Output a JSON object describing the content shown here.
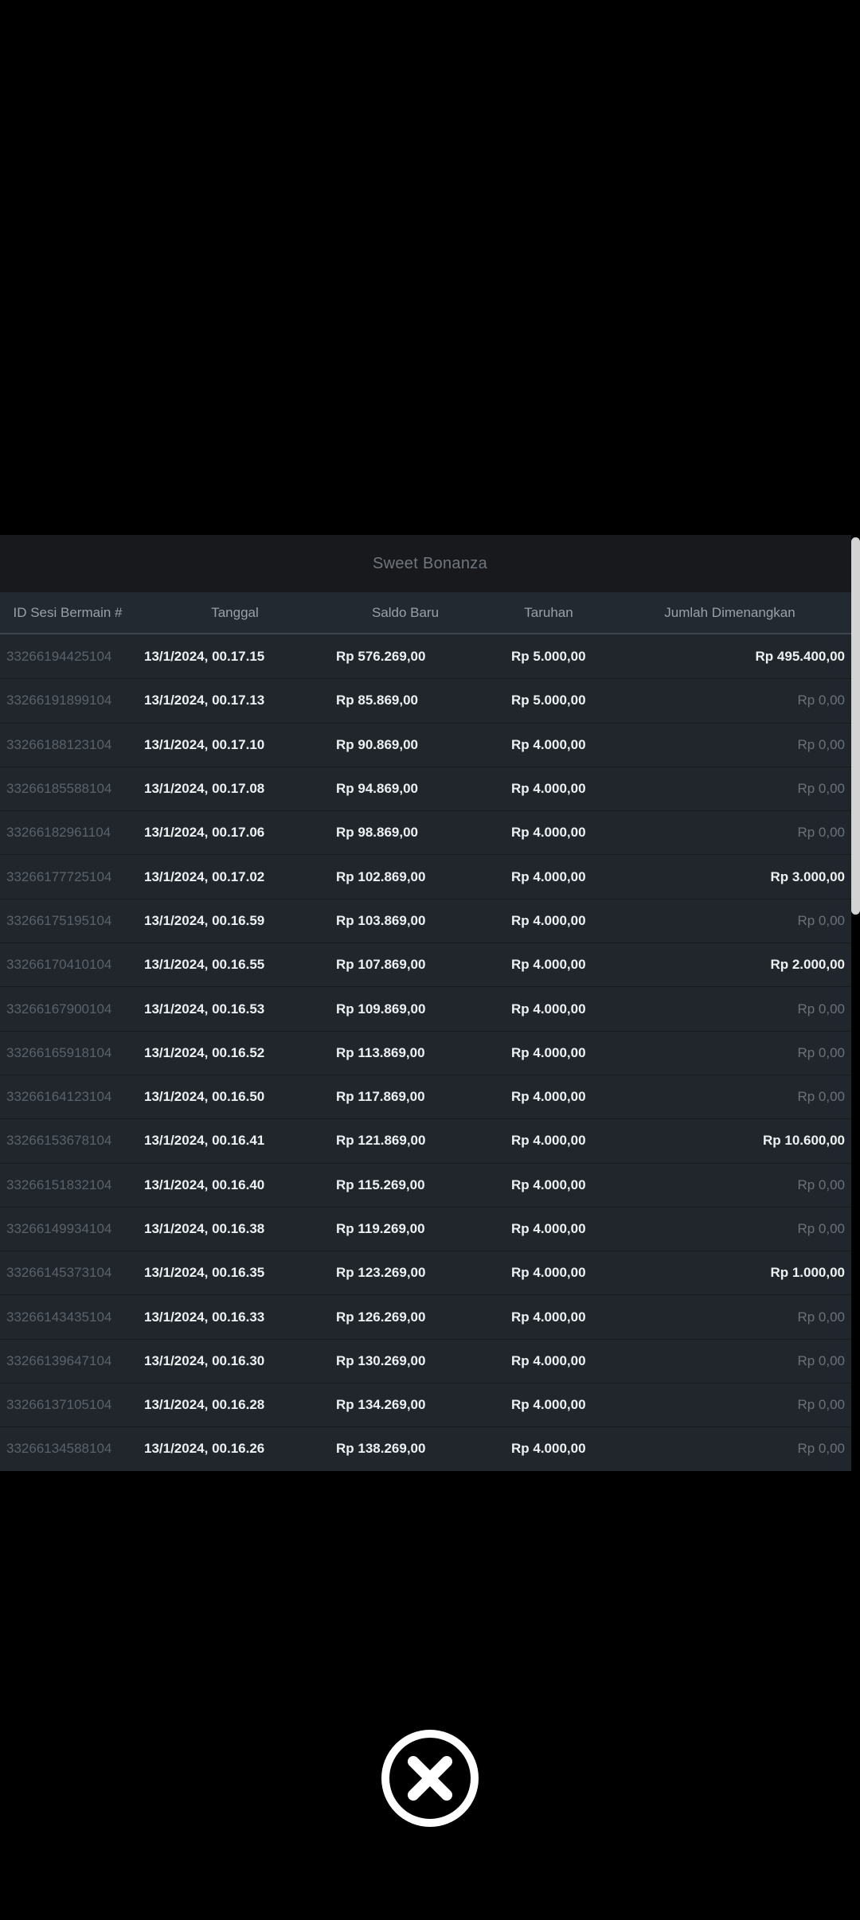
{
  "modal": {
    "title": "Sweet Bonanza",
    "columns": [
      "ID Sesi Bermain #",
      "Tanggal",
      "Saldo Baru",
      "Taruhan",
      "Jumlah Dimenangkan"
    ],
    "zero_value": "Rp 0,00",
    "rows": [
      {
        "id": "33266194425104",
        "tanggal": "13/1/2024, 00.17.15",
        "saldo_baru": "Rp 576.269,00",
        "taruhan": "Rp 5.000,00",
        "jumlah_dimenangkan": "Rp 495.400,00"
      },
      {
        "id": "33266191899104",
        "tanggal": "13/1/2024, 00.17.13",
        "saldo_baru": "Rp 85.869,00",
        "taruhan": "Rp 5.000,00",
        "jumlah_dimenangkan": "Rp 0,00"
      },
      {
        "id": "33266188123104",
        "tanggal": "13/1/2024, 00.17.10",
        "saldo_baru": "Rp 90.869,00",
        "taruhan": "Rp 4.000,00",
        "jumlah_dimenangkan": "Rp 0,00"
      },
      {
        "id": "33266185588104",
        "tanggal": "13/1/2024, 00.17.08",
        "saldo_baru": "Rp 94.869,00",
        "taruhan": "Rp 4.000,00",
        "jumlah_dimenangkan": "Rp 0,00"
      },
      {
        "id": "33266182961104",
        "tanggal": "13/1/2024, 00.17.06",
        "saldo_baru": "Rp 98.869,00",
        "taruhan": "Rp 4.000,00",
        "jumlah_dimenangkan": "Rp 0,00"
      },
      {
        "id": "33266177725104",
        "tanggal": "13/1/2024, 00.17.02",
        "saldo_baru": "Rp 102.869,00",
        "taruhan": "Rp 4.000,00",
        "jumlah_dimenangkan": "Rp 3.000,00"
      },
      {
        "id": "33266175195104",
        "tanggal": "13/1/2024, 00.16.59",
        "saldo_baru": "Rp 103.869,00",
        "taruhan": "Rp 4.000,00",
        "jumlah_dimenangkan": "Rp 0,00"
      },
      {
        "id": "33266170410104",
        "tanggal": "13/1/2024, 00.16.55",
        "saldo_baru": "Rp 107.869,00",
        "taruhan": "Rp 4.000,00",
        "jumlah_dimenangkan": "Rp 2.000,00"
      },
      {
        "id": "33266167900104",
        "tanggal": "13/1/2024, 00.16.53",
        "saldo_baru": "Rp 109.869,00",
        "taruhan": "Rp 4.000,00",
        "jumlah_dimenangkan": "Rp 0,00"
      },
      {
        "id": "33266165918104",
        "tanggal": "13/1/2024, 00.16.52",
        "saldo_baru": "Rp 113.869,00",
        "taruhan": "Rp 4.000,00",
        "jumlah_dimenangkan": "Rp 0,00"
      },
      {
        "id": "33266164123104",
        "tanggal": "13/1/2024, 00.16.50",
        "saldo_baru": "Rp 117.869,00",
        "taruhan": "Rp 4.000,00",
        "jumlah_dimenangkan": "Rp 0,00"
      },
      {
        "id": "33266153678104",
        "tanggal": "13/1/2024, 00.16.41",
        "saldo_baru": "Rp 121.869,00",
        "taruhan": "Rp 4.000,00",
        "jumlah_dimenangkan": "Rp 10.600,00"
      },
      {
        "id": "33266151832104",
        "tanggal": "13/1/2024, 00.16.40",
        "saldo_baru": "Rp 115.269,00",
        "taruhan": "Rp 4.000,00",
        "jumlah_dimenangkan": "Rp 0,00"
      },
      {
        "id": "33266149934104",
        "tanggal": "13/1/2024, 00.16.38",
        "saldo_baru": "Rp 119.269,00",
        "taruhan": "Rp 4.000,00",
        "jumlah_dimenangkan": "Rp 0,00"
      },
      {
        "id": "33266145373104",
        "tanggal": "13/1/2024, 00.16.35",
        "saldo_baru": "Rp 123.269,00",
        "taruhan": "Rp 4.000,00",
        "jumlah_dimenangkan": "Rp 1.000,00"
      },
      {
        "id": "33266143435104",
        "tanggal": "13/1/2024, 00.16.33",
        "saldo_baru": "Rp 126.269,00",
        "taruhan": "Rp 4.000,00",
        "jumlah_dimenangkan": "Rp 0,00"
      },
      {
        "id": "33266139647104",
        "tanggal": "13/1/2024, 00.16.30",
        "saldo_baru": "Rp 130.269,00",
        "taruhan": "Rp 4.000,00",
        "jumlah_dimenangkan": "Rp 0,00"
      },
      {
        "id": "33266137105104",
        "tanggal": "13/1/2024, 00.16.28",
        "saldo_baru": "Rp 134.269,00",
        "taruhan": "Rp 4.000,00",
        "jumlah_dimenangkan": "Rp 0,00"
      },
      {
        "id": "33266134588104",
        "tanggal": "13/1/2024, 00.16.26",
        "saldo_baru": "Rp 138.269,00",
        "taruhan": "Rp 4.000,00",
        "jumlah_dimenangkan": "Rp 0,00"
      }
    ]
  },
  "close_button": {
    "icon": "x-circle"
  },
  "colors": {
    "page_bg": "#000000",
    "title_bar_bg": "#17191d",
    "header_bg": "#232930",
    "row_bg": "#20262c",
    "row_separator": "#171b20",
    "text_primary": "#eef1f3",
    "text_id": "#5a626b",
    "text_zero": "#6b7177",
    "text_title": "#70767d",
    "text_header": "#9aa0a6",
    "scrollbar_thumb": "#d3d3d3"
  }
}
